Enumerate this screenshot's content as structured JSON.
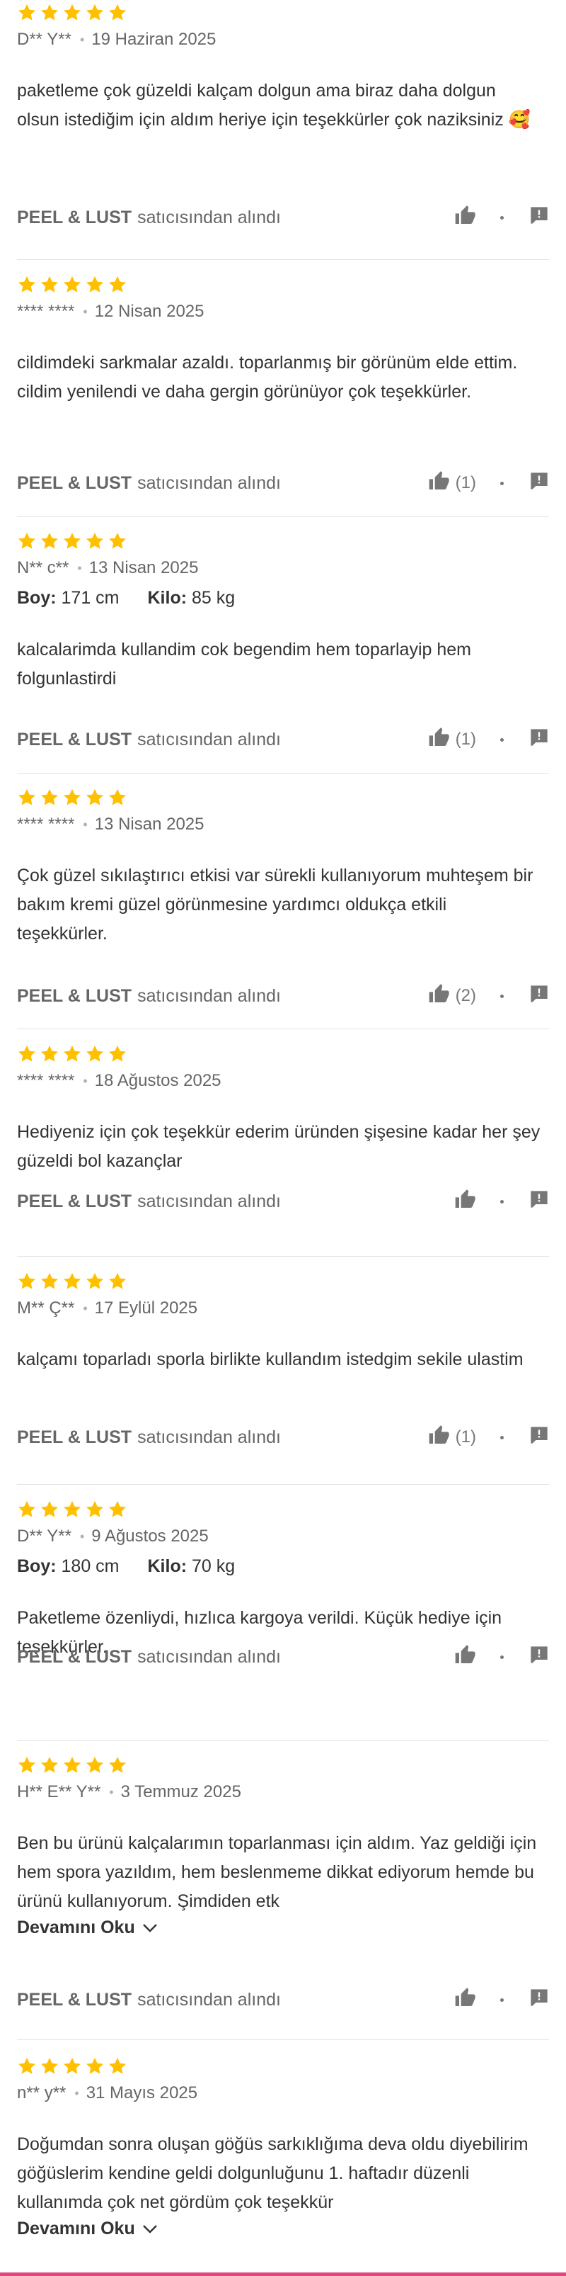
{
  "seller_suffix": "satıcısından alındı",
  "height_label": "Boy:",
  "weight_label": "Kilo:",
  "more_label": "Devamını Oku",
  "colors": {
    "star": "#ffc000",
    "text": "#333333",
    "muted": "#666666",
    "divider": "#e2e2e2",
    "accent": "#e2457c"
  },
  "reviews": [
    {
      "rating": 5,
      "user": "D** Y**",
      "date": "19 Haziran 2025",
      "height": null,
      "weight": null,
      "comment": "paketleme çok güzeldi kalçam dolgun ama biraz daha dolgun olsun istediğim için aldım heriye için teşekkürler çok naziksiniz 🥰",
      "truncated": false,
      "seller": "PEEL & LUST",
      "likes": null
    },
    {
      "rating": 5,
      "user": "**** ****",
      "date": "12 Nisan 2025",
      "height": null,
      "weight": null,
      "comment": "cildimdeki sarkmalar azaldı. toparlanmış bir görünüm elde ettim. cildim yenilendi ve daha gergin görünüyor çok teşekkürler.",
      "truncated": false,
      "seller": "PEEL & LUST",
      "likes": "(1)"
    },
    {
      "rating": 5,
      "user": "N** c**",
      "date": "13 Nisan 2025",
      "height": "171 cm",
      "weight": "85 kg",
      "comment": "kalcalarimda kullandim cok begendim hem toparlayip hem folgunlastirdi",
      "truncated": false,
      "seller": "PEEL & LUST",
      "likes": "(1)"
    },
    {
      "rating": 5,
      "user": "**** ****",
      "date": "13 Nisan 2025",
      "height": null,
      "weight": null,
      "comment": "Çok güzel sıkılaştırıcı etkisi var sürekli kullanıyorum muhteşem bir bakım kremi güzel görünmesine yardımcı oldukça etkili teşekkürler.",
      "truncated": false,
      "seller": "PEEL & LUST",
      "likes": "(2)"
    },
    {
      "rating": 5,
      "user": "**** ****",
      "date": "18 Ağustos 2025",
      "height": null,
      "weight": null,
      "comment": "Hediyeniz için çok teşekkür ederim üründen şişesine kadar her şey güzeldi bol kazançlar",
      "truncated": false,
      "seller": "PEEL & LUST",
      "likes": null
    },
    {
      "rating": 5,
      "user": "M** Ç**",
      "date": "17 Eylül 2025",
      "height": null,
      "weight": null,
      "comment": "kalçamı toparladı sporla birlikte kullandım istedgim sekile ulastim",
      "truncated": false,
      "seller": "PEEL & LUST",
      "likes": "(1)"
    },
    {
      "rating": 5,
      "user": "D** Y**",
      "date": "9 Ağustos 2025",
      "height": "180 cm",
      "weight": "70 kg",
      "comment": "Paketleme özenliydi, hızlıca kargoya verildi. Küçük hediye için teşekkürler.",
      "truncated": false,
      "seller": "PEEL & LUST",
      "likes": null
    },
    {
      "rating": 5,
      "user": "H** E** Y**",
      "date": "3 Temmuz 2025",
      "height": null,
      "weight": null,
      "comment": "Ben bu ürünü kalçalarımın toparlanması için aldım. Yaz geldiği için hem spora yazıldım, hem beslenmeme dikkat ediyorum hemde bu ürünü kullanıyorum. Şimdiden etk",
      "truncated": true,
      "seller": "PEEL & LUST",
      "likes": null
    },
    {
      "rating": 5,
      "user": "n** y**",
      "date": "31 Mayıs 2025",
      "height": null,
      "weight": null,
      "comment": "Doğumdan sonra oluşan göğüs sarkıklığıma deva oldu diyebilirim göğüslerim kendine geldi dolgunluğunu 1. haftadır düzenli kullanımda çok net gördüm çok teşekkür",
      "truncated": true,
      "seller": "PEEL & LUST",
      "likes": null
    }
  ]
}
